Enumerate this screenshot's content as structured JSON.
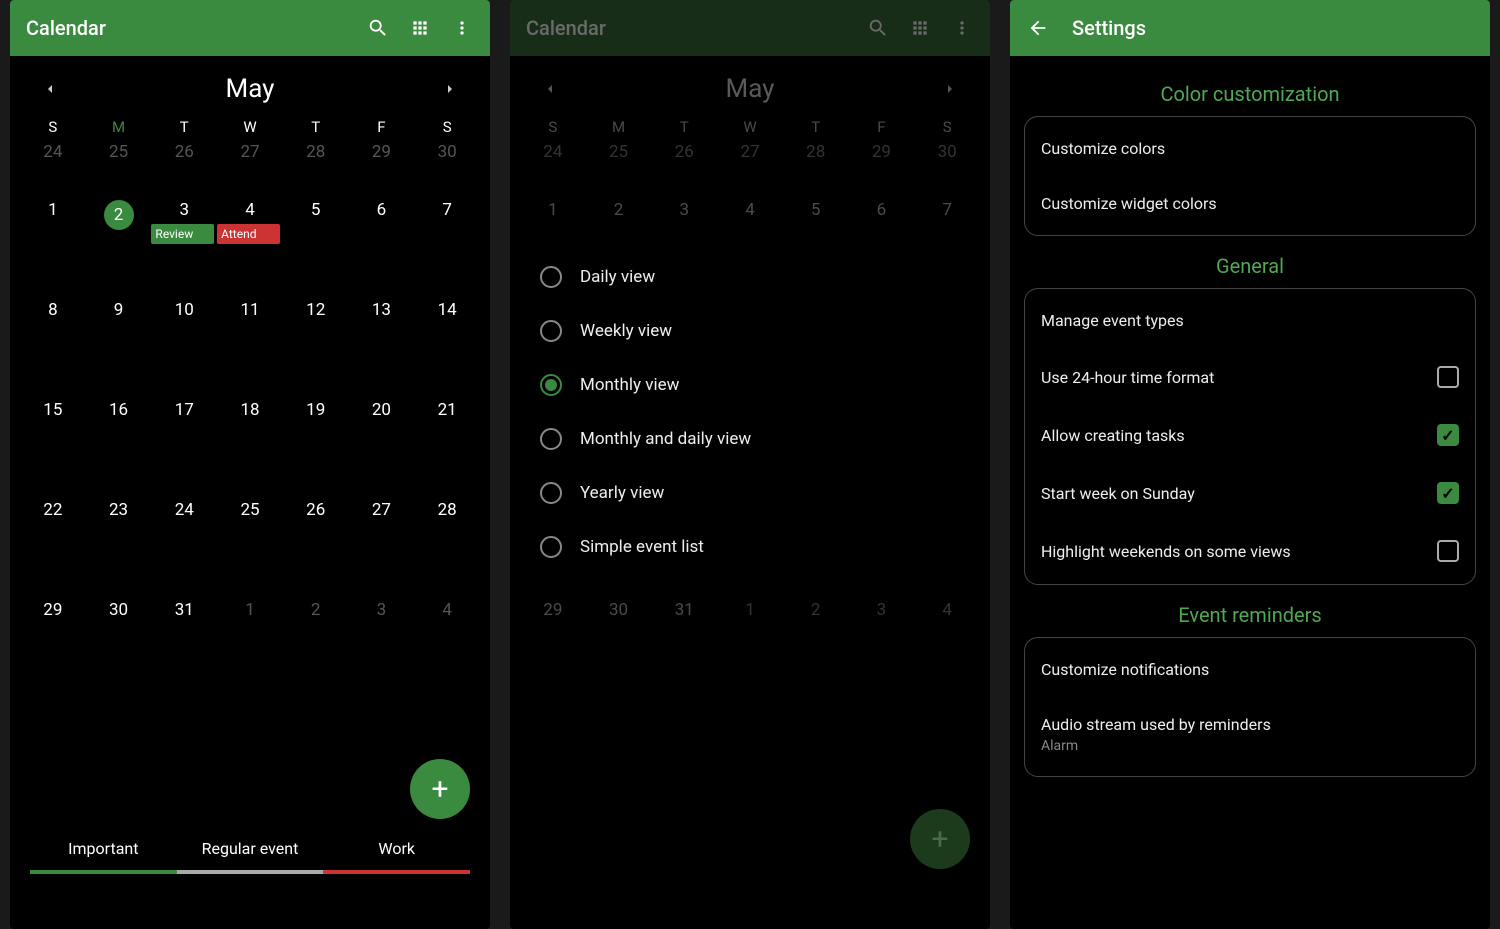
{
  "colors": {
    "primary": "#3a8a3f",
    "green_chip": "#3a8a3f",
    "red_chip": "#cc3333"
  },
  "panel1": {
    "title": "Calendar",
    "month": "May",
    "daylabels": [
      "S",
      "M",
      "T",
      "W",
      "T",
      "F",
      "S"
    ],
    "weeks": [
      [
        {
          "n": "24",
          "fade": true
        },
        {
          "n": "25",
          "fade": true
        },
        {
          "n": "26",
          "fade": true
        },
        {
          "n": "27",
          "fade": true
        },
        {
          "n": "28",
          "fade": true
        },
        {
          "n": "29",
          "fade": true
        },
        {
          "n": "30",
          "fade": true
        }
      ],
      [
        {
          "n": "1"
        },
        {
          "n": "2",
          "today": true
        },
        {
          "n": "3"
        },
        {
          "n": "4"
        },
        {
          "n": "5"
        },
        {
          "n": "6"
        },
        {
          "n": "7"
        }
      ],
      [
        {
          "n": "8"
        },
        {
          "n": "9"
        },
        {
          "n": "10"
        },
        {
          "n": "11"
        },
        {
          "n": "12"
        },
        {
          "n": "13"
        },
        {
          "n": "14"
        }
      ],
      [
        {
          "n": "15"
        },
        {
          "n": "16"
        },
        {
          "n": "17"
        },
        {
          "n": "18"
        },
        {
          "n": "19"
        },
        {
          "n": "20"
        },
        {
          "n": "21"
        }
      ],
      [
        {
          "n": "22"
        },
        {
          "n": "23"
        },
        {
          "n": "24"
        },
        {
          "n": "25"
        },
        {
          "n": "26"
        },
        {
          "n": "27"
        },
        {
          "n": "28"
        }
      ],
      [
        {
          "n": "29"
        },
        {
          "n": "30"
        },
        {
          "n": "31"
        },
        {
          "n": "1",
          "fade": true
        },
        {
          "n": "2",
          "fade": true
        },
        {
          "n": "3",
          "fade": true
        },
        {
          "n": "4",
          "fade": true
        }
      ]
    ],
    "events": {
      "review": "Review",
      "attend": "Attend"
    },
    "filters": [
      "Important",
      "Regular event",
      "Work"
    ],
    "filter_underlines": [
      "#3a8a3f",
      "#aaaaaa",
      "#cc3333"
    ]
  },
  "panel2": {
    "title": "Calendar",
    "month": "May",
    "views": [
      {
        "label": "Daily view",
        "checked": false
      },
      {
        "label": "Weekly view",
        "checked": false
      },
      {
        "label": "Monthly view",
        "checked": true
      },
      {
        "label": "Monthly and daily view",
        "checked": false
      },
      {
        "label": "Yearly view",
        "checked": false
      },
      {
        "label": "Simple event list",
        "checked": false
      }
    ]
  },
  "panel3": {
    "title": "Settings",
    "sections": {
      "color": {
        "title": "Color customization",
        "items": [
          "Customize colors",
          "Customize widget colors"
        ]
      },
      "general": {
        "title": "General",
        "items": [
          {
            "label": "Manage event types",
            "type": "nav"
          },
          {
            "label": "Use 24-hour time format",
            "type": "check",
            "checked": false
          },
          {
            "label": "Allow creating tasks",
            "type": "check",
            "checked": true
          },
          {
            "label": "Start week on Sunday",
            "type": "check",
            "checked": true
          },
          {
            "label": "Highlight weekends on some views",
            "type": "check",
            "checked": false
          }
        ]
      },
      "reminders": {
        "title": "Event reminders",
        "items": [
          {
            "label": "Customize notifications",
            "type": "nav"
          },
          {
            "label": "Audio stream used by reminders",
            "sub": "Alarm",
            "type": "sub"
          }
        ]
      }
    }
  }
}
